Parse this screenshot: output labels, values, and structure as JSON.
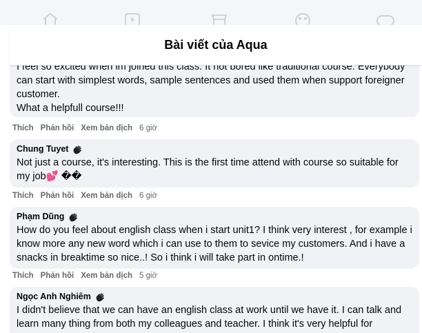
{
  "modal": {
    "title": "Bài viết của Aqua"
  },
  "nav": {
    "icons": [
      "home-icon",
      "watch-icon",
      "marketplace-icon",
      "groups-icon",
      "gaming-icon"
    ]
  },
  "labels": {
    "like": "Thích",
    "reply": "Phản hồi",
    "translate": "Xem bản dịch"
  },
  "comments": [
    {
      "author": "",
      "text": "I feel so excited when im joined this class. It not bored like traditional course. Everybody can start with simplest words, sample sentences and used them when support foreigner customer.\nWhat a helpfull course!!!",
      "time": "6 giờ"
    },
    {
      "author": "Chung Tuyet",
      "text": "Not just a course, it's interesting. This is the first time attend with course so suitable for my job💕 ��",
      "time": "6 giờ"
    },
    {
      "author": "Phạm Dũng",
      "text": "How do you feel about english class when i start unit1? I think very interest , for example i know more any new word which i can use to them to sevice my customers. And i have a snacks in breaktime so nice..! So i think i will take part in ontime.!",
      "time": "5 giờ"
    },
    {
      "author": "Ngọc Anh Nghiêm",
      "text": "I didn't believe that we can have an english class at work until we have it. I can talk and learn many thing from both my colleagues and teacher. I think it's very helpful for",
      "time": ""
    }
  ]
}
